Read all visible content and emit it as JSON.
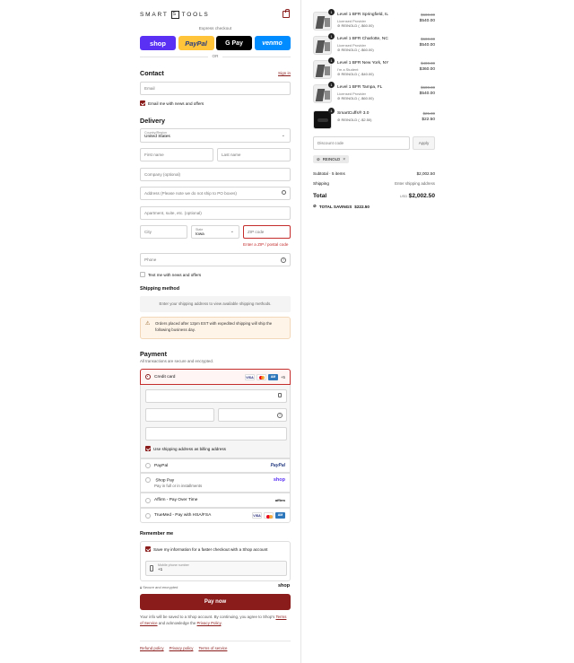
{
  "brand": {
    "name_left": "SMART",
    "name_mid": "S",
    "name_right": "TOOLS"
  },
  "express": {
    "label": "Express checkout",
    "buttons": [
      "shop",
      "PayPal",
      "G Pay",
      "venmo"
    ],
    "or": "OR"
  },
  "contact": {
    "title": "Contact",
    "sign_in": "Sign in",
    "email_placeholder": "Email",
    "news_label": "Email me with news and offers"
  },
  "delivery": {
    "title": "Delivery",
    "country_label": "Country/Region",
    "country_value": "United States",
    "first_name": "First name",
    "last_name": "Last name",
    "company": "Company (optional)",
    "address": "Address (Please note we do not ship to PO boxes)",
    "apartment": "Apartment, suite, etc. (optional)",
    "city": "City",
    "state_label": "State",
    "state_value": "Iowa",
    "zip": "ZIP code",
    "zip_error": "Enter a ZIP / postal code",
    "phone": "Phone",
    "text_label": "Text me with news and offers"
  },
  "shipping": {
    "title": "Shipping method",
    "placeholder": "Enter your shipping address to view available shipping methods.",
    "notice": "Orders placed after 12pm EST with expedited shipping will ship the following business day."
  },
  "payment": {
    "title": "Payment",
    "subtitle": "All transactions are secure and encrypted.",
    "credit_card": "Credit card",
    "more_cards": "+5",
    "billing_label": "Use shipping address as billing address",
    "paypal": "PayPal",
    "shop_pay": "Shop Pay",
    "shop_pay_sub": "Pay in full or in installments",
    "affirm": "Affirm - Pay Over Time",
    "truemed": "TrueMed - Pay with HSA/FSA",
    "brand_paypal": "PayPal",
    "brand_shop": "shop",
    "brand_affirm": "affirm"
  },
  "remember": {
    "title": "Remember me",
    "save_label": "Save my information for a faster checkout with a Shop account",
    "phone_label": "Mobile phone number",
    "phone_value": "+1",
    "secure": "Secure and encrypted",
    "shop": "shop"
  },
  "pay_now": "Pay now",
  "legal": {
    "line1": "Your info will be saved to a Shop account. By continuing, you agree to Shop's",
    "tos": "Terms of Service",
    "and": "and acknowledge the",
    "privacy": "Privacy Policy",
    "dot": "."
  },
  "footer": {
    "refund": "Refund policy",
    "privacy": "Privacy policy",
    "terms": "Terms of service"
  },
  "items": [
    {
      "qty": "1",
      "name": "Level 1 BFR Springfield, IL",
      "sub": "Licensed Provider",
      "code": "REINOLD ( -$60.00)",
      "old": "$600.00",
      "new": "$540.00"
    },
    {
      "qty": "1",
      "name": "Level 1 BFR Charlotte, NC",
      "sub": "Licensed Provider",
      "code": "REINOLD ( -$60.00)",
      "old": "$600.00",
      "new": "$540.00"
    },
    {
      "qty": "1",
      "name": "Level 1 BFR New York, NY",
      "sub": "I'm a Student",
      "code": "REINOLD ( -$40.00)",
      "old": "$400.00",
      "new": "$360.00"
    },
    {
      "qty": "1",
      "name": "Level 1 BFR Tampa, FL",
      "sub": "Licensed Provider",
      "code": "REINOLD ( -$60.00)",
      "old": "$600.00",
      "new": "$540.00"
    },
    {
      "qty": "1",
      "name": "SmartCuffs® 3.0",
      "sub": "",
      "code": "REINOLD ( -$2.50)",
      "old": "$25.00",
      "new": "$22.50"
    }
  ],
  "discount": {
    "placeholder": "Discount code",
    "apply": "Apply",
    "applied": "REINOLD"
  },
  "summary": {
    "subtotal_label": "Subtotal · 5 items",
    "subtotal_value": "$2,002.50",
    "shipping_label": "Shipping",
    "shipping_value": "Enter shipping address",
    "total_label": "Total",
    "currency": "USD",
    "total_value": "$2,002.50",
    "savings_label": "TOTAL SAVINGS",
    "savings_value": "$222.50"
  },
  "colors": {
    "accent": "#8a1c1c",
    "shop": "#5a31f4",
    "paypal": "#ffc439",
    "venmo": "#008cff",
    "error": "#c42b2b"
  }
}
